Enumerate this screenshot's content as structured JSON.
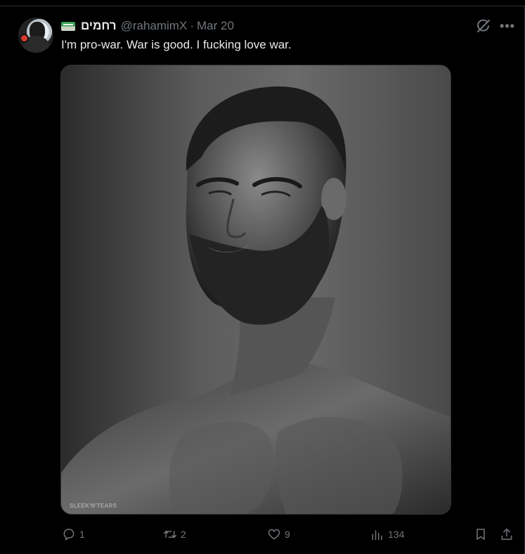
{
  "tweet": {
    "display_name": "רחמים",
    "handle": "@rahamimX",
    "separator": "·",
    "date": "Mar 20",
    "text": "I'm pro-war. War is good. I fucking love war.",
    "media": {
      "watermark": "SLEEK'N'TEARS"
    }
  },
  "actions": {
    "replies": "1",
    "reposts": "2",
    "likes": "9",
    "views": "134"
  },
  "icons": {
    "flag": "flag-icon",
    "grok": "grok-icon",
    "more": "more-icon",
    "reply": "reply-icon",
    "repost": "repost-icon",
    "like": "heart-icon",
    "views": "views-icon",
    "bookmark": "bookmark-icon",
    "share": "share-icon"
  },
  "colors": {
    "background": "#000000",
    "text": "#e7e9ea",
    "muted": "#71767b",
    "border": "#2f3336"
  }
}
